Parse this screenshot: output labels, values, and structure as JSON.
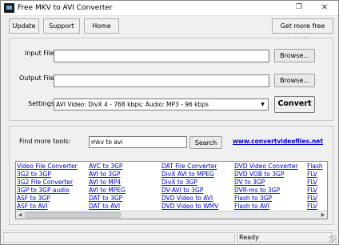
{
  "window": {
    "title": "Free MKV to AVI Converter"
  },
  "titlebar": {
    "restore_glyph": "❐",
    "close_glyph": "✕"
  },
  "menu": {
    "update": "Update",
    "support": "Support",
    "home": "Home",
    "more_tools": "Get more free tools"
  },
  "form": {
    "input_label": "Input File",
    "input_value": "",
    "output_label": "Output File",
    "output_value": "",
    "browse_label": "Browse...",
    "settings_label": "Settings",
    "settings_value": "AVI Video: DivX 4 - 768 kbps; Audio: MP3 - 96 kbps",
    "convert_label": "Convert"
  },
  "tools": {
    "find_label": "Find more tools:",
    "search_value": "mkv to avi",
    "search_button": "Search",
    "website": "www.convertvideofiles.net",
    "columns": [
      [
        "Video File Converter",
        "3G2 to 3GP",
        "3G2 File Converter",
        "3GP to 3GP audio",
        "ASF to 3GP",
        "ASF to AVI"
      ],
      [
        "AVC to 3GP",
        "AVI to 3GP",
        "AVI to MP4",
        "AVI to MPEG",
        "DAT to 3GP",
        "DAT to AVI"
      ],
      [
        "DAT File Converter",
        "DivX AVI to MPEG",
        "DivX to 3GP",
        "DV-AVI to 3GP",
        "DVD Video to AVI",
        "DVD Video to WMV"
      ],
      [
        "DVD Video Converter",
        "DVD VOB to 3GP",
        "DV to 3GP",
        "DVR-ms to 3GP",
        "Flash to 3GP",
        "Flash to AVI"
      ],
      [
        "Flash",
        "FLV",
        "FLV",
        "FLV",
        "FLV",
        "FLV"
      ]
    ]
  },
  "status": {
    "text": "Ready"
  },
  "icons": {
    "app": "app-icon",
    "dropdown": "chevron-down-icon",
    "scroll_left": "arrow-left-icon",
    "scroll_right": "arrow-right-icon"
  },
  "colors": {
    "link": "#0000cc",
    "window_bg": "#f0f0f0"
  }
}
